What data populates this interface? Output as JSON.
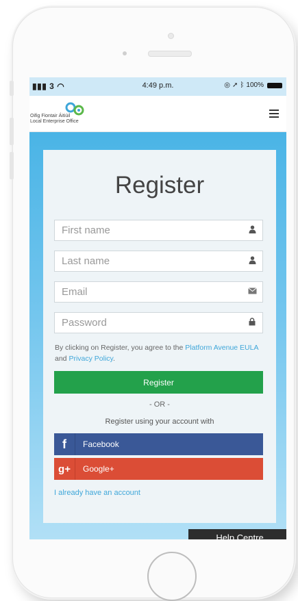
{
  "status_bar": {
    "carrier": "3",
    "time": "4:49 p.m.",
    "battery": "100%"
  },
  "header": {
    "logo_line1": "Oifig Fiontair Áitiúil",
    "logo_line2": "Local Enterprise Office",
    "menu_icon": "hamburger-icon"
  },
  "form": {
    "title": "Register",
    "first_name_placeholder": "First name",
    "last_name_placeholder": "Last name",
    "email_placeholder": "Email",
    "password_placeholder": "Password",
    "terms_prefix": "By clicking on Register, you agree to the ",
    "terms_link1": "Platform Avenue EULA",
    "terms_mid": " and ",
    "terms_link2": "Privacy Policy",
    "terms_suffix": ".",
    "register_button": "Register",
    "or_text": "- OR -",
    "social_prompt": "Register using your account with",
    "facebook_label": "Facebook",
    "google_label": "Google+",
    "already_account": "I already have an account"
  },
  "help": {
    "label": "Help Centre"
  },
  "colors": {
    "register_green": "#23a14b",
    "facebook_blue": "#3a5897",
    "google_red": "#db4d36",
    "link_blue": "#3ea6d9",
    "background_blue": "#49b3e4"
  }
}
